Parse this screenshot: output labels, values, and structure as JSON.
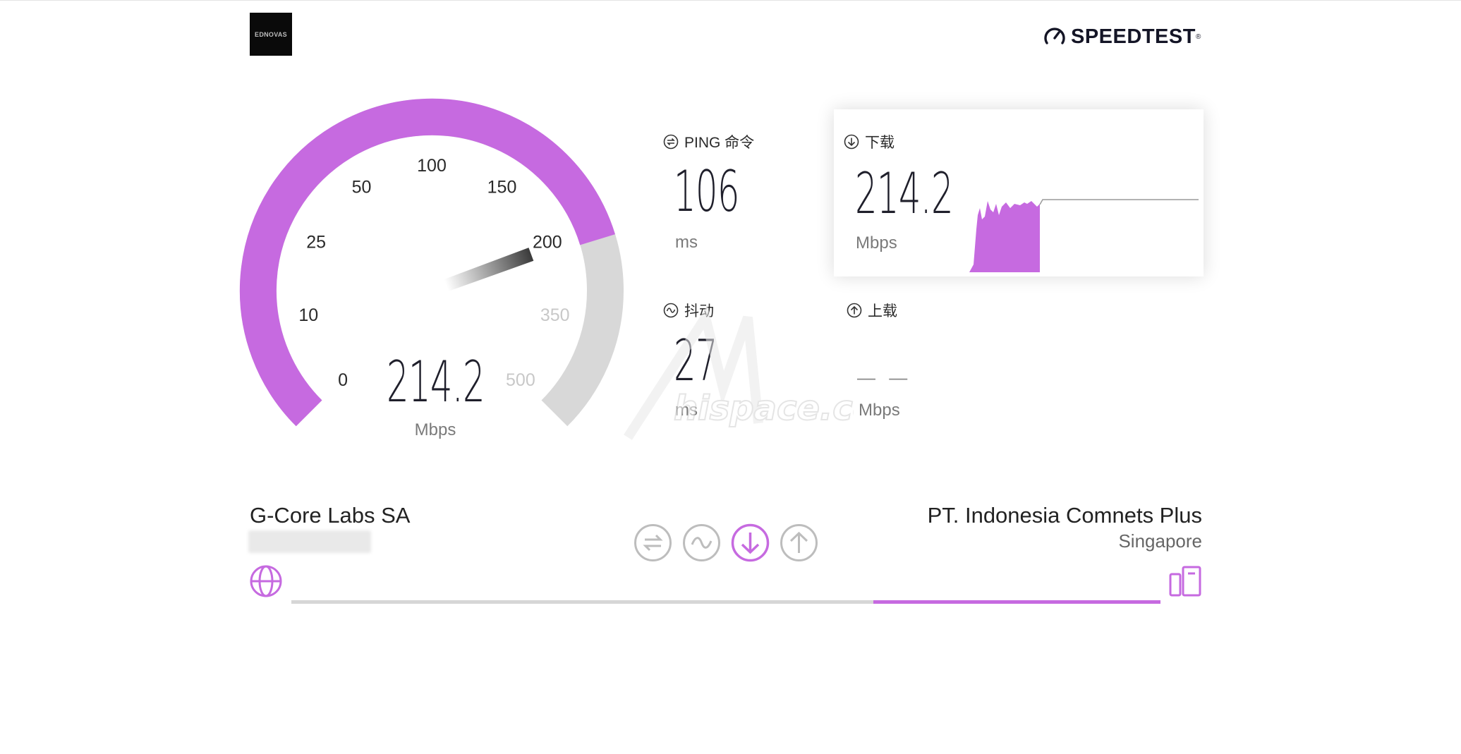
{
  "logo": {
    "text": "EDNOVAS"
  },
  "brand": {
    "name": "SPEEDTEST",
    "tm": "®",
    "icon": "gauge-icon"
  },
  "gauge": {
    "ticks": [
      "0",
      "10",
      "25",
      "50",
      "100",
      "150",
      "200",
      "350",
      "500"
    ],
    "value": "214.2",
    "unit": "Mbps",
    "progress_fraction": 0.77,
    "accent_color": "#c66ae0",
    "track_color": "#d8d8d8"
  },
  "metrics": {
    "ping": {
      "label": "PING 命令",
      "value": "106",
      "unit": "ms",
      "icon": "ping-icon"
    },
    "jitter": {
      "label": "抖动",
      "value": "27",
      "unit": "ms",
      "icon": "jitter-icon"
    },
    "download": {
      "label": "下载",
      "value": "214.2",
      "unit": "Mbps",
      "icon": "download-icon"
    },
    "upload": {
      "label": "上载",
      "value": "— —",
      "unit": "Mbps",
      "icon": "upload-icon"
    }
  },
  "provider": {
    "name": "G-Core Labs SA"
  },
  "server": {
    "name": "PT. Indonesia Comnets Plus",
    "location": "Singapore"
  },
  "steps": [
    {
      "name": "ping",
      "icon": "ping-icon",
      "active": false
    },
    {
      "name": "jitter",
      "icon": "jitter-icon",
      "active": false
    },
    {
      "name": "download",
      "icon": "download-icon",
      "active": true
    },
    {
      "name": "upload",
      "icon": "upload-icon",
      "active": false
    }
  ],
  "test_progress_fraction": 0.67,
  "watermark": {
    "text": "hispace.cc"
  }
}
